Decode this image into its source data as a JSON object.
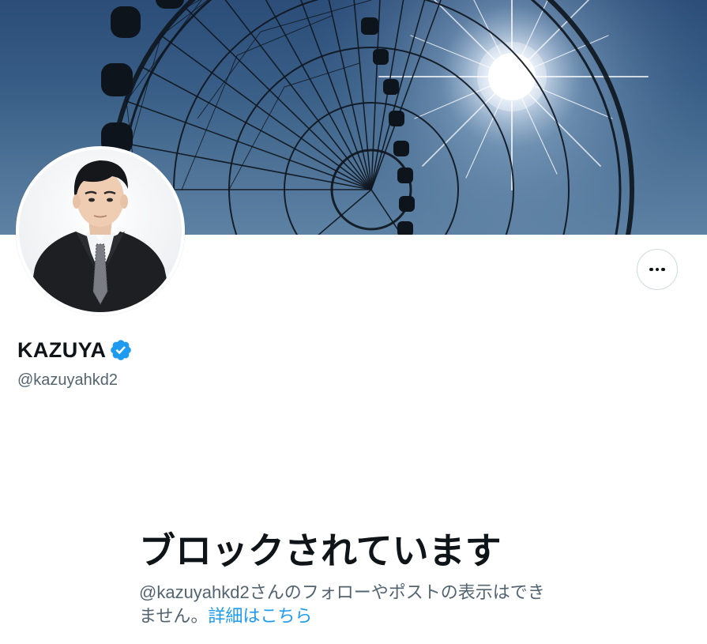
{
  "profile": {
    "display_name": "KAZUYA",
    "handle": "@kazuyahkd2",
    "verified": true,
    "banner_image": "ferris-wheel-with-sun",
    "avatar_image": "man-in-dark-suit-portrait"
  },
  "header": {
    "more_icon": "ellipsis-icon"
  },
  "blocked": {
    "title": "ブロックされています",
    "message": "@kazuyahkd2さんのフォローやポストの表示はできません。",
    "link_label": "詳細はこちら"
  },
  "colors": {
    "text_primary": "#0f1419",
    "text_secondary": "#536471",
    "link": "#1d9bf0",
    "verified": "#1d9bf0",
    "border": "#cfd9de"
  }
}
